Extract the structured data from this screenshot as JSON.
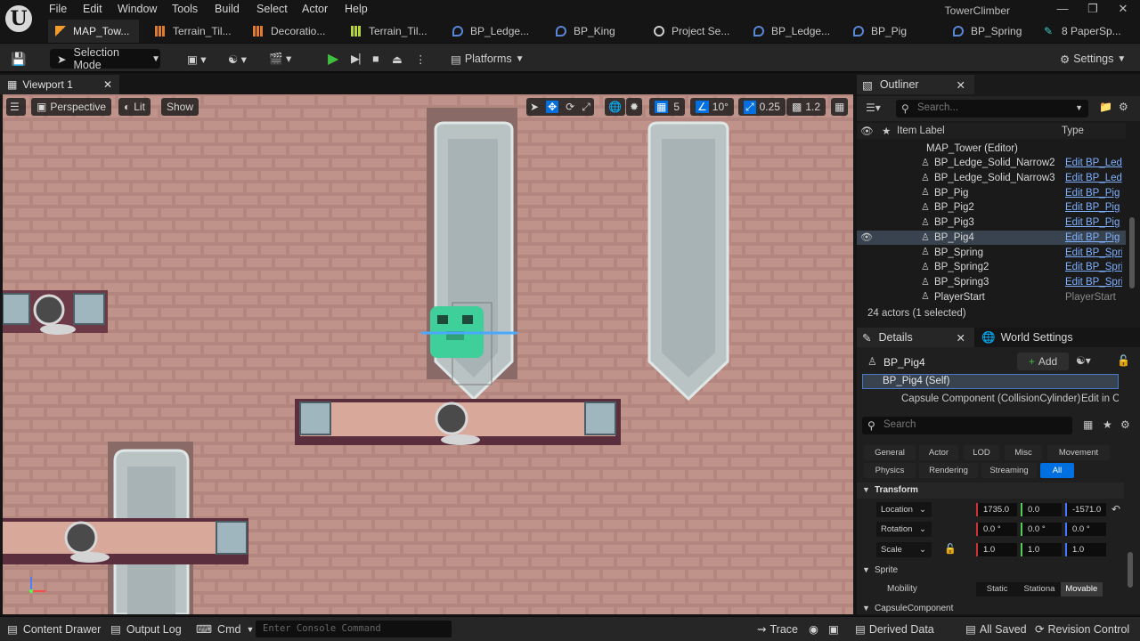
{
  "menubar": {
    "items": [
      "File",
      "Edit",
      "Window",
      "Tools",
      "Build",
      "Select",
      "Actor",
      "Help"
    ],
    "app_title": "TowerClimber"
  },
  "tabs": [
    {
      "label": "MAP_Tow...",
      "icon": "level-icon"
    },
    {
      "label": "Terrain_Til...",
      "icon": "tilemap-icon"
    },
    {
      "label": "Decoratio...",
      "icon": "tilemap-icon"
    },
    {
      "label": "Terrain_Til...",
      "icon": "tileset-icon"
    },
    {
      "label": "BP_Ledge...",
      "icon": "blueprint-icon"
    },
    {
      "label": "BP_King",
      "icon": "blueprint-icon"
    },
    {
      "label": "Project Se...",
      "icon": "settings-icon"
    },
    {
      "label": "BP_Ledge...",
      "icon": "blueprint-icon"
    },
    {
      "label": "BP_Pig",
      "icon": "blueprint-icon"
    },
    {
      "label": "BP_Spring",
      "icon": "blueprint-icon"
    },
    {
      "label": "8 PaperSp...",
      "icon": "papersprite-icon"
    }
  ],
  "toolbar": {
    "selection_mode": "Selection Mode",
    "platforms": "Platforms",
    "settings": "Settings"
  },
  "viewport": {
    "tab_label": "Viewport 1",
    "perspective": "Perspective",
    "lit": "Lit",
    "show": "Show",
    "grid_snap": "5",
    "rotation_snap": "10°",
    "scale_snap": "0.25",
    "camera_speed": "1.2"
  },
  "outliner": {
    "title": "Outliner",
    "search_placeholder": "Search...",
    "col_label": "Item Label",
    "col_type": "Type",
    "root": "MAP_Tower (Editor)",
    "rows": [
      {
        "label": "BP_Ledge_Solid_Narrow2",
        "type": "Edit BP_Ledg"
      },
      {
        "label": "BP_Ledge_Solid_Narrow3",
        "type": "Edit BP_Ledg"
      },
      {
        "label": "BP_Pig",
        "type": "Edit BP_Pig"
      },
      {
        "label": "BP_Pig2",
        "type": "Edit BP_Pig"
      },
      {
        "label": "BP_Pig3",
        "type": "Edit BP_Pig"
      },
      {
        "label": "BP_Pig4",
        "type": "Edit BP_Pig"
      },
      {
        "label": "BP_Spring",
        "type": "Edit BP_Sprin"
      },
      {
        "label": "BP_Spring2",
        "type": "Edit BP_Sprin"
      },
      {
        "label": "BP_Spring3",
        "type": "Edit BP_Sprin"
      },
      {
        "label": "PlayerStart",
        "type": "PlayerStart"
      }
    ],
    "status": "24 actors (1 selected)"
  },
  "details": {
    "title": "Details",
    "world_settings": "World Settings",
    "actor_name": "BP_Pig4",
    "add_label": "Add",
    "self_row": "BP_Pig4 (Self)",
    "component_row": "Capsule Component (CollisionCylinder)",
    "component_edit": "Edit in C",
    "search_placeholder": "Search",
    "categories_row1": [
      "General",
      "Actor",
      "LOD",
      "Misc",
      "Movement"
    ],
    "categories_row2": [
      "Physics",
      "Rendering",
      "Streaming",
      "All"
    ],
    "section_transform": "Transform",
    "location_label": "Location",
    "location": [
      "1735.0",
      "0.0",
      "-1571.0"
    ],
    "rotation_label": "Rotation",
    "rotation": [
      "0.0 °",
      "0.0 °",
      "0.0 °"
    ],
    "scale_label": "Scale",
    "scale": [
      "1.0",
      "1.0",
      "1.0"
    ],
    "section_sprite": "Sprite",
    "mobility_label": "Mobility",
    "mobility_options": [
      "Static",
      "Stationa",
      "Movable"
    ],
    "section_capsule": "CapsuleComponent"
  },
  "statusbar": {
    "content_drawer": "Content Drawer",
    "output_log": "Output Log",
    "cmd": "Cmd",
    "console_placeholder": "Enter Console Command",
    "trace": "Trace",
    "derived_data": "Derived Data",
    "all_saved": "All Saved",
    "revision_control": "Revision Control"
  },
  "colors": {
    "accent": "#0070e0",
    "selected_row": "#39424f",
    "link": "#7fb0ff",
    "brick": "#b3877f"
  }
}
